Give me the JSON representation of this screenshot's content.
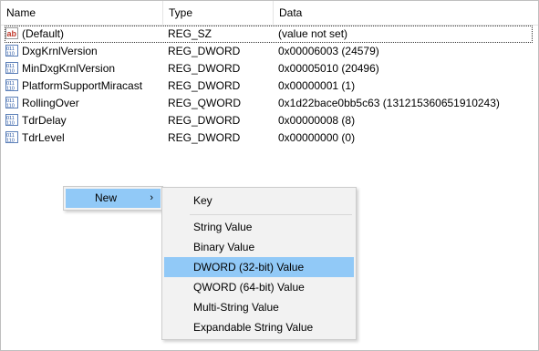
{
  "columns": {
    "name": "Name",
    "type": "Type",
    "data": "Data"
  },
  "rows": [
    {
      "icon": "string-value-icon",
      "name": "(Default)",
      "type": "REG_SZ",
      "data": "(value not set)"
    },
    {
      "icon": "binary-value-icon",
      "name": "DxgKrnlVersion",
      "type": "REG_DWORD",
      "data": "0x00006003 (24579)"
    },
    {
      "icon": "binary-value-icon",
      "name": "MinDxgKrnlVersion",
      "type": "REG_DWORD",
      "data": "0x00005010 (20496)"
    },
    {
      "icon": "binary-value-icon",
      "name": "PlatformSupportMiracast",
      "type": "REG_DWORD",
      "data": "0x00000001 (1)"
    },
    {
      "icon": "binary-value-icon",
      "name": "RollingOver",
      "type": "REG_QWORD",
      "data": "0x1d22bace0bb5c63 (131215360651910243)"
    },
    {
      "icon": "binary-value-icon",
      "name": "TdrDelay",
      "type": "REG_DWORD",
      "data": "0x00000008 (8)"
    },
    {
      "icon": "binary-value-icon",
      "name": "TdrLevel",
      "type": "REG_DWORD",
      "data": "0x00000000 (0)"
    }
  ],
  "context_menu": {
    "new_label": "New",
    "arrow": "›"
  },
  "submenu": {
    "key": "Key",
    "string_value": "String Value",
    "binary_value": "Binary Value",
    "dword_value": "DWORD (32-bit) Value",
    "qword_value": "QWORD (64-bit) Value",
    "multi_string_value": "Multi-String Value",
    "expandable_string_value": "Expandable String Value"
  },
  "colors": {
    "highlight": "#91c9f7",
    "menu_bg": "#f2f2f2"
  }
}
